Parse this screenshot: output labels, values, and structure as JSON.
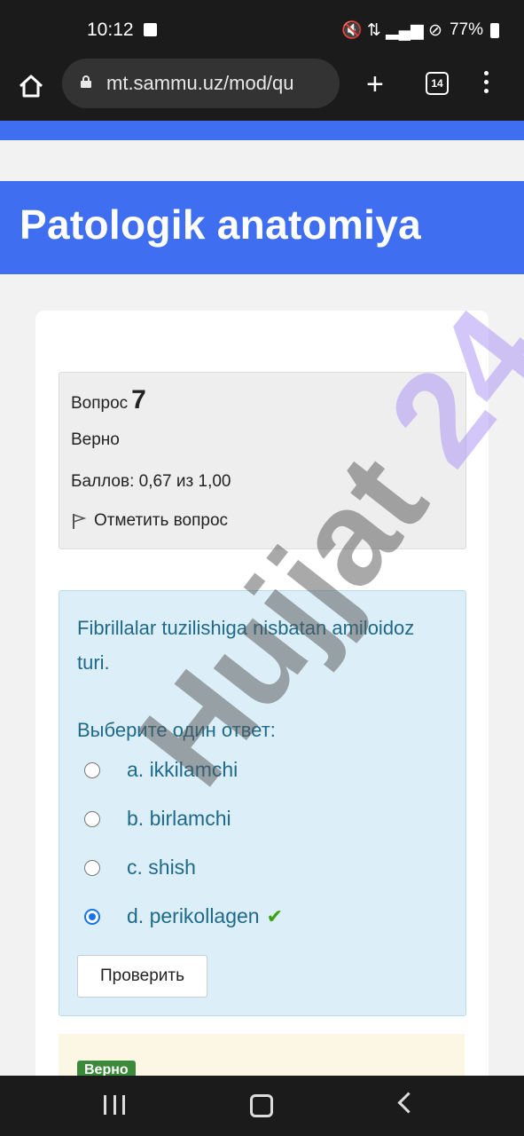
{
  "status_bar": {
    "time": "10:12",
    "battery": "77%",
    "signal_glyphs": "🔇 ⇅ ▂▄▆ ⊘"
  },
  "browser": {
    "url": "mt.sammu.uz/mod/qu",
    "tab_count": "14",
    "new_tab": "+"
  },
  "page": {
    "course_title": "Patologik anatomiya"
  },
  "question_info": {
    "label": "Вопрос",
    "number": "7",
    "state": "Верно",
    "grade": "Баллов: 0,67 из 1,00",
    "flag_label": "Отметить вопрос"
  },
  "question": {
    "text": "Fibrillalar tuzilishiga nisbatan amiloidoz turi.",
    "prompt": "Выберите один ответ:",
    "options": [
      {
        "label": "a. ikkilamchi",
        "selected": false
      },
      {
        "label": "b. birlamchi",
        "selected": false
      },
      {
        "label": "c. shish",
        "selected": false
      },
      {
        "label": "d. perikollagen",
        "selected": true,
        "correct_mark": "✔"
      }
    ],
    "check_button": "Проверить"
  },
  "feedback": {
    "badge": "Верно"
  },
  "watermark": {
    "part1": "Hujjat",
    "part2": "24"
  },
  "colors": {
    "brand_blue": "#3f6ff0",
    "question_bg": "#dceef7",
    "correct_green": "#3aa312"
  }
}
